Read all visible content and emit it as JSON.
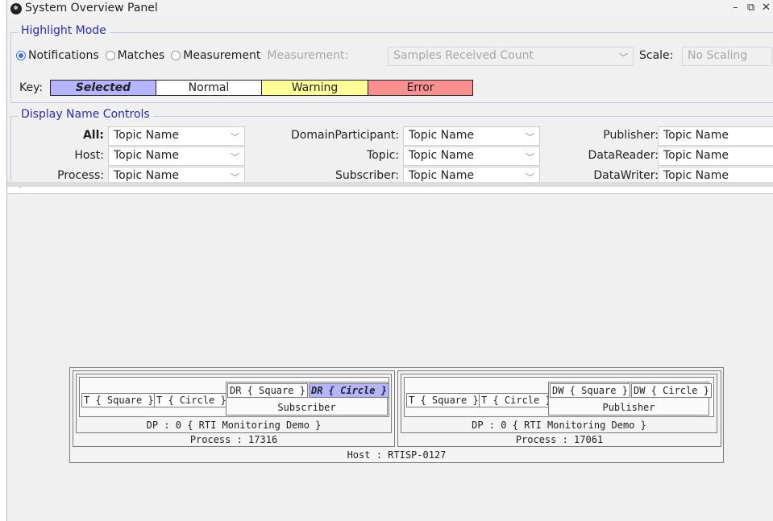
{
  "window": {
    "title": "System Overview Panel",
    "controls": {
      "minimize": "–",
      "restore": "⧉",
      "close": "✕"
    }
  },
  "highlight_mode": {
    "legend": "Highlight Mode",
    "options": [
      {
        "label": "Notifications",
        "checked": true
      },
      {
        "label": "Matches",
        "checked": false
      },
      {
        "label": "Measurement",
        "checked": false
      }
    ],
    "measurement_label": "Measurement:",
    "measurement_value": "Samples Received Count",
    "scale_label": "Scale:",
    "scale_value": "No Scaling",
    "key_label": "Key:",
    "key": [
      {
        "label": "Selected",
        "color": "#b4b4ff"
      },
      {
        "label": "Normal",
        "color": "#ffffff"
      },
      {
        "label": "Warning",
        "color": "#ffff99"
      },
      {
        "label": "Error",
        "color": "#f89090"
      }
    ]
  },
  "display_name_controls": {
    "legend": "Display Name Controls",
    "fields": {
      "all": {
        "label": "All:",
        "value": "Topic Name"
      },
      "host": {
        "label": "Host:",
        "value": "Topic Name"
      },
      "process": {
        "label": "Process:",
        "value": "Topic Name"
      },
      "domain_participant": {
        "label": "DomainParticipant:",
        "value": "Topic Name"
      },
      "topic": {
        "label": "Topic:",
        "value": "Topic Name"
      },
      "subscriber": {
        "label": "Subscriber:",
        "value": "Topic Name"
      },
      "publisher": {
        "label": "Publisher:",
        "value": "Topic Name"
      },
      "data_reader": {
        "label": "DataReader:",
        "value": "Topic Name"
      },
      "data_writer": {
        "label": "DataWriter:",
        "value": "Topic Name"
      }
    }
  },
  "diagram": {
    "host": "Host : RTISP-0127",
    "processes": [
      {
        "label": "Process : 17316",
        "participant": "DP : 0 { RTI Monitoring Demo }",
        "topics": [
          "T { Square }",
          "T { Circle }"
        ],
        "group_label": "Subscriber",
        "endpoints": [
          "DR { Square }",
          "DR { Circle }"
        ]
      },
      {
        "label": "Process : 17061",
        "participant": "DP : 0 { RTI Monitoring Demo }",
        "topics": [
          "T { Square }",
          "T { Circle }"
        ],
        "group_label": "Publisher",
        "endpoints": [
          "DW { Square }",
          "DW { Circle }"
        ]
      }
    ]
  }
}
